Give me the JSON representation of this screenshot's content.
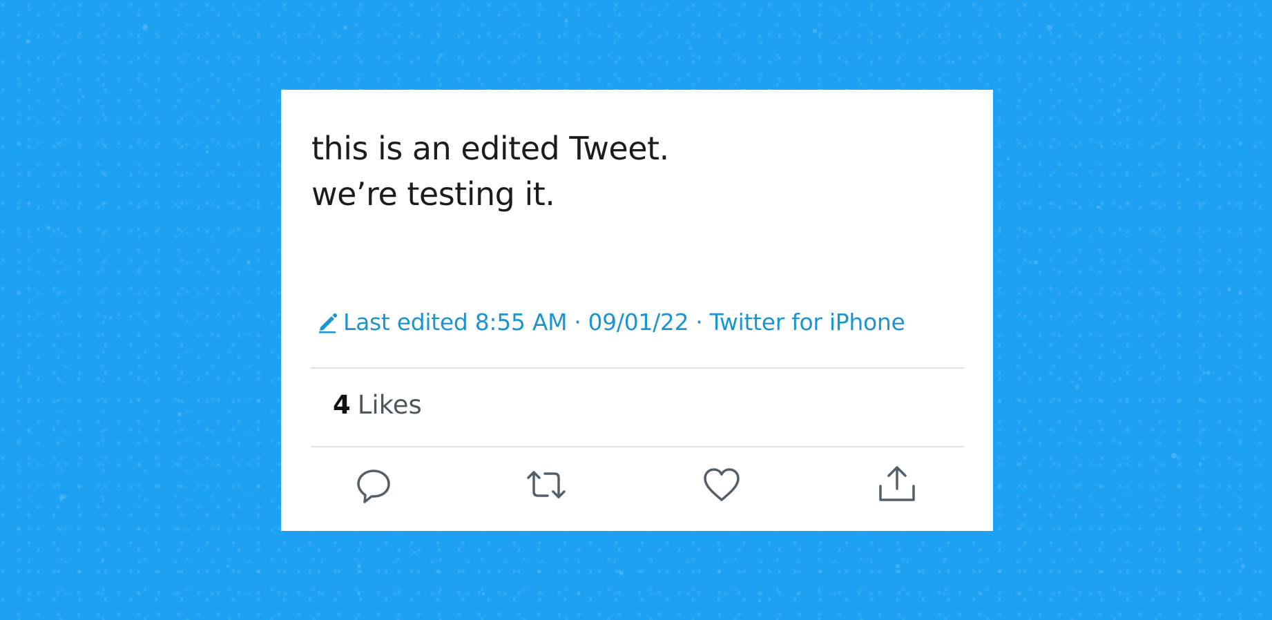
{
  "tweet": {
    "lines": [
      "this is an edited Tweet.",
      "we’re testing it."
    ],
    "edit_icon": "pencil-icon",
    "edited_label": "Last edited 8:55 AM",
    "separator": "·",
    "date": "09/01/22",
    "source": "Twitter for iPhone",
    "likes_count": "4",
    "likes_label": "Likes"
  },
  "actions": [
    {
      "icon": "reply-icon"
    },
    {
      "icon": "retweet-icon"
    },
    {
      "icon": "like-icon"
    },
    {
      "icon": "share-icon"
    }
  ],
  "colors": {
    "background": "#1da1f2",
    "card": "#ffffff",
    "text": "#1c1c1c",
    "meta": "#1b94d1",
    "icon": "#53606b",
    "divider": "#dfe3e6"
  }
}
